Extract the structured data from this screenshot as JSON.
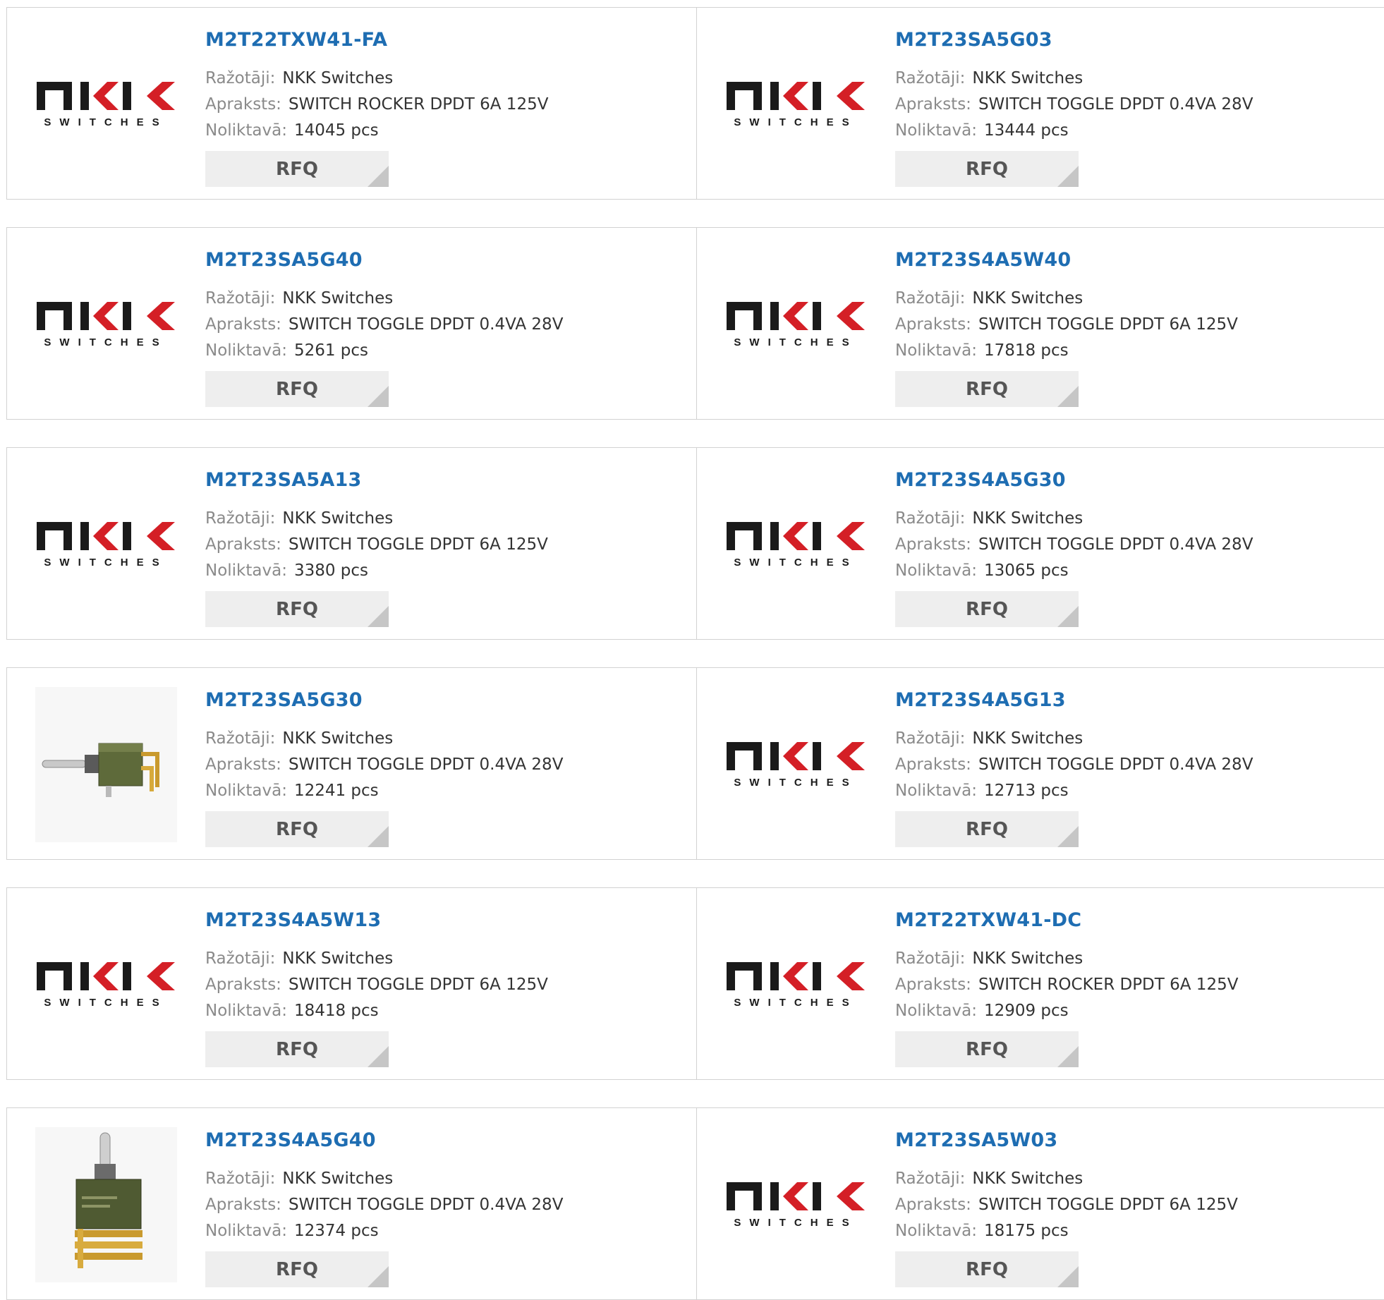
{
  "labels": {
    "manufacturer": "Ražotāji:",
    "description": "Apraksts:",
    "stock": "Noliktavā:",
    "rfq": "RFQ"
  },
  "products": [
    {
      "part": "M2T22TXW41-FA",
      "manufacturer": "NKK Switches",
      "description": "SWITCH ROCKER DPDT 6A 125V",
      "stock": "14045 pcs",
      "image": "nkk-logo"
    },
    {
      "part": "M2T23SA5G03",
      "manufacturer": "NKK Switches",
      "description": "SWITCH TOGGLE DPDT 0.4VA 28V",
      "stock": "13444 pcs",
      "image": "nkk-logo"
    },
    {
      "part": "M2T23SA5G40",
      "manufacturer": "NKK Switches",
      "description": "SWITCH TOGGLE DPDT 0.4VA 28V",
      "stock": "5261 pcs",
      "image": "nkk-logo"
    },
    {
      "part": "M2T23S4A5W40",
      "manufacturer": "NKK Switches",
      "description": "SWITCH TOGGLE DPDT 6A 125V",
      "stock": "17818 pcs",
      "image": "nkk-logo"
    },
    {
      "part": "M2T23SA5A13",
      "manufacturer": "NKK Switches",
      "description": "SWITCH TOGGLE DPDT 6A 125V",
      "stock": "3380 pcs",
      "image": "nkk-logo"
    },
    {
      "part": "M2T23S4A5G30",
      "manufacturer": "NKK Switches",
      "description": "SWITCH TOGGLE DPDT 0.4VA 28V",
      "stock": "13065 pcs",
      "image": "nkk-logo"
    },
    {
      "part": "M2T23SA5G30",
      "manufacturer": "NKK Switches",
      "description": "SWITCH TOGGLE DPDT 0.4VA 28V",
      "stock": "12241 pcs",
      "image": "toggle-switch-side-photo"
    },
    {
      "part": "M2T23S4A5G13",
      "manufacturer": "NKK Switches",
      "description": "SWITCH TOGGLE DPDT 0.4VA 28V",
      "stock": "12713 pcs",
      "image": "nkk-logo"
    },
    {
      "part": "M2T23S4A5W13",
      "manufacturer": "NKK Switches",
      "description": "SWITCH TOGGLE DPDT 6A 125V",
      "stock": "18418 pcs",
      "image": "nkk-logo"
    },
    {
      "part": "M2T22TXW41-DC",
      "manufacturer": "NKK Switches",
      "description": "SWITCH ROCKER DPDT 6A 125V",
      "stock": "12909 pcs",
      "image": "nkk-logo"
    },
    {
      "part": "M2T23S4A5G40",
      "manufacturer": "NKK Switches",
      "description": "SWITCH TOGGLE DPDT 0.4VA 28V",
      "stock": "12374 pcs",
      "image": "toggle-switch-top-photo"
    },
    {
      "part": "M2T23SA5W03",
      "manufacturer": "NKK Switches",
      "description": "SWITCH TOGGLE DPDT 6A 125V",
      "stock": "18175 pcs",
      "image": "nkk-logo"
    }
  ],
  "logo_text": {
    "brand": "NKK",
    "tagline": "SWITCHES"
  }
}
